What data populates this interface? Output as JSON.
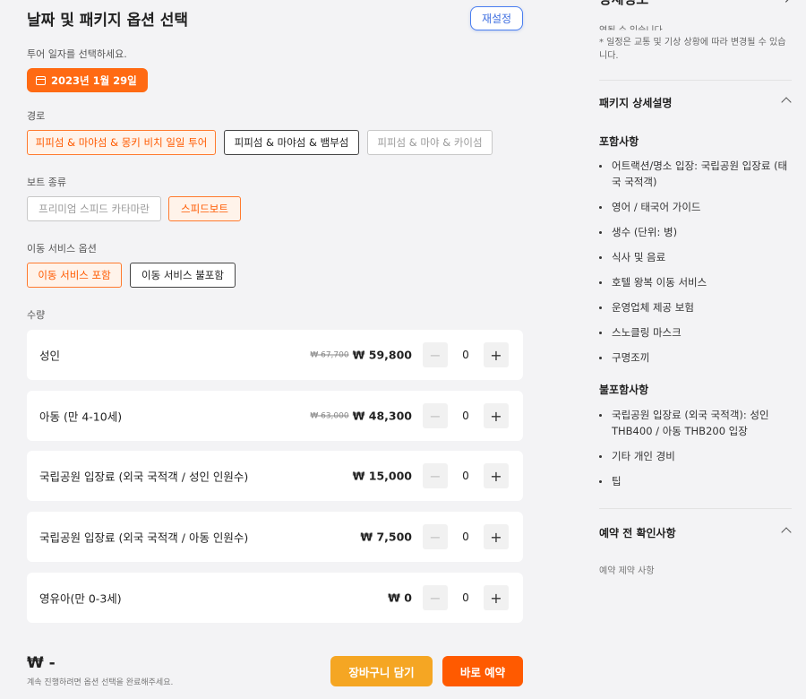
{
  "header": {
    "title": "날짜 및 패키지 옵션 선택",
    "reset_label": "재설정"
  },
  "date": {
    "label": "투어 일자를 선택하세요.",
    "value": "2023년 1월 29일"
  },
  "route": {
    "label": "경로",
    "options": [
      {
        "label": "피피섬 & 마야섬 & 몽키 비치 일일 투어",
        "state": "selected"
      },
      {
        "label": "피피섬 & 마야섬 & 뱀부섬",
        "state": "normal"
      },
      {
        "label": "피피섬 & 마야 & 카이섬",
        "state": "disabled"
      }
    ]
  },
  "boat": {
    "label": "보트 종류",
    "options": [
      {
        "label": "프리미엄 스피드 카타마란",
        "state": "disabled"
      },
      {
        "label": "스피드보트",
        "state": "selected"
      }
    ]
  },
  "transfer": {
    "label": "이동 서비스 옵션",
    "options": [
      {
        "label": "이동 서비스 포함",
        "state": "selected"
      },
      {
        "label": "이동 서비스 불포함",
        "state": "normal"
      }
    ]
  },
  "quantity": {
    "label": "수량",
    "items": [
      {
        "name": "성인",
        "original_price": "₩ 67,700",
        "price": "₩ 59,800",
        "count": "0"
      },
      {
        "name": "아동 (만 4-10세)",
        "original_price": "₩ 63,000",
        "price": "₩ 48,300",
        "count": "0"
      },
      {
        "name": "국립공원 입장료 (외국 국적객 / 성인 인원수)",
        "original_price": "",
        "price": "₩ 15,000",
        "count": "0"
      },
      {
        "name": "국립공원 입장료 (외국 국적객 / 아동 인원수)",
        "original_price": "",
        "price": "₩ 7,500",
        "count": "0"
      },
      {
        "name": "영유아(만 0-3세)",
        "original_price": "",
        "price": "₩ 0",
        "count": "0"
      }
    ],
    "minus": "−",
    "plus": "+"
  },
  "footer": {
    "total": "₩ -",
    "note": "계속 진행하려면 옵션 선택을 완료해주세요.",
    "cart_label": "장바구니 담기",
    "buy_label": "바로 예약"
  },
  "details": {
    "title": "상세정보",
    "expand_icon": "↗",
    "top_cut_text": "영될 수 있습니다.",
    "top_note": "* 일정은 교통 및 기상 상황에 따라 변경될 수 있습니다.",
    "package_section": "패키지 상세설명",
    "included_title": "포함사항",
    "included": [
      "어트랙션/명소 입장: 국립공원 입장료 (태국 국적객)",
      "영어 / 태국어 가이드",
      "생수 (단위: 병)",
      "식사 및 음료",
      "호텔 왕복 이동 서비스",
      "운영업체 제공 보험",
      "스노클링 마스크",
      "구명조끼"
    ],
    "excluded_title": "불포함사항",
    "excluded": [
      "국립공원 입장료 (외국 국적객): 성인 THB400 / 아동 THB200 입장",
      "기타 개인 경비",
      "팁"
    ],
    "pre_booking_section": "예약 전 확인사항",
    "bottom_cut_text": "예약 제약 사항"
  }
}
